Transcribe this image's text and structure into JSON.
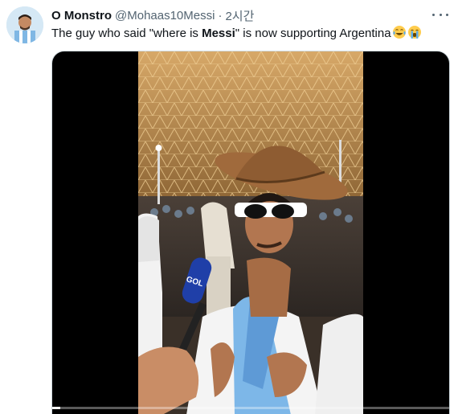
{
  "tweet": {
    "display_name": "O Monstro",
    "handle": "@Mohaas10Messi",
    "separator": "·",
    "timestamp": "2시간",
    "text_before": "The guy who said \"where is ",
    "text_bold": "Messi",
    "text_after": "\" is now supporting Argentina"
  },
  "icons": {
    "avatar": "avatar-image",
    "more": "more-options-icon",
    "emoji_1": "face-with-tears-of-joy-emoji",
    "emoji_2": "loudly-crying-face-emoji"
  },
  "video": {
    "mic_label": "GOL",
    "progress_fraction": 0.02
  },
  "colors": {
    "text_primary": "#0f1419",
    "text_secondary": "#536471",
    "media_bg": "#000000"
  }
}
